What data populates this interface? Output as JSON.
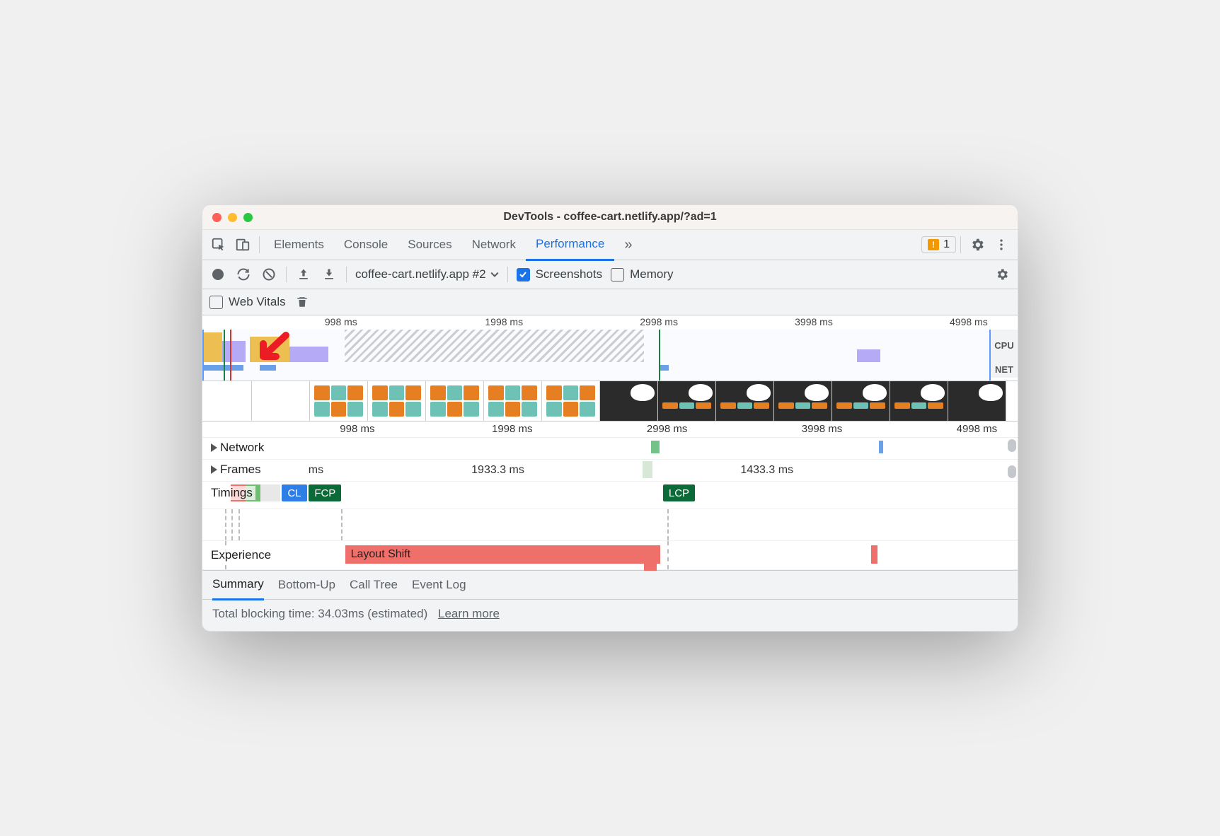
{
  "window_title": "DevTools - coffee-cart.netlify.app/?ad=1",
  "main_tabs": {
    "items": [
      "Elements",
      "Console",
      "Sources",
      "Network",
      "Performance"
    ],
    "active": "Performance",
    "more_indicator": "»",
    "issues_count": "1"
  },
  "perf_toolbar": {
    "recording_selector": "coffee-cart.netlify.app #2",
    "screenshots_label": "Screenshots",
    "screenshots_checked": true,
    "memory_label": "Memory",
    "memory_checked": false,
    "web_vitals_label": "Web Vitals",
    "web_vitals_checked": false
  },
  "overview": {
    "ticks": [
      "998 ms",
      "1998 ms",
      "2998 ms",
      "3998 ms",
      "4998 ms"
    ],
    "row_labels": {
      "cpu": "CPU",
      "net": "NET"
    }
  },
  "flamechart": {
    "ticks": [
      "998 ms",
      "1998 ms",
      "2998 ms",
      "3998 ms",
      "4998 ms"
    ],
    "tracks": {
      "network": "Network",
      "frames": "Frames",
      "timings": "Timings",
      "experience": "Experience"
    },
    "frames_durations": {
      "left": "ms",
      "mid": "1933.3 ms",
      "right": "1433.3 ms"
    },
    "timing_badges": {
      "cls": "CL",
      "fcp": "FCP",
      "lcp": "LCP"
    },
    "layout_shift_label": "Layout Shift"
  },
  "bottom_tabs": {
    "items": [
      "Summary",
      "Bottom-Up",
      "Call Tree",
      "Event Log"
    ],
    "active": "Summary"
  },
  "summary": {
    "text": "Total blocking time: 34.03ms (estimated)",
    "learn_more": "Learn more"
  }
}
